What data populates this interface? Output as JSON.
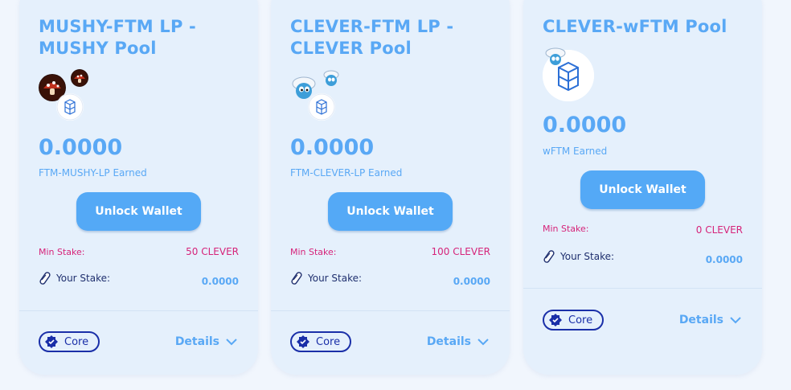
{
  "pools": [
    {
      "title": "MUSHY-FTM LP - MUSHY Pool",
      "earned_value": "0.0000",
      "earned_label": "FTM-MUSHY-LP Earned",
      "button_label": "Unlock Wallet",
      "min_stake_label": "Min Stake:",
      "min_stake_value": "50 CLEVER",
      "your_stake_label": "Your Stake:",
      "your_stake_value": "0.0000",
      "badge_label": "Core",
      "details_label": "Details"
    },
    {
      "title": "CLEVER-FTM LP - CLEVER Pool",
      "earned_value": "0.0000",
      "earned_label": "FTM-CLEVER-LP Earned",
      "button_label": "Unlock Wallet",
      "min_stake_label": "Min Stake:",
      "min_stake_value": "100 CLEVER",
      "your_stake_label": "Your Stake:",
      "your_stake_value": "0.0000",
      "badge_label": "Core",
      "details_label": "Details"
    },
    {
      "title": "CLEVER-wFTM Pool",
      "earned_value": "0.0000",
      "earned_label": "wFTM Earned",
      "button_label": "Unlock Wallet",
      "min_stake_label": "Min Stake:",
      "min_stake_value": "0 CLEVER",
      "your_stake_label": "Your Stake:",
      "your_stake_value": "0.0000",
      "badge_label": "Core",
      "details_label": "Details"
    }
  ],
  "colors": {
    "card_bg": "#e5f0fc",
    "accent": "#59a8f5",
    "button": "#54a9f6",
    "pink": "#d6247a",
    "navy": "#1a2fa8"
  },
  "icons": [
    "mushroom-token-icon",
    "smurf-token-icon",
    "fantom-token-icon",
    "stake-pill-icon",
    "verified-check-icon",
    "chevron-down-icon"
  ]
}
